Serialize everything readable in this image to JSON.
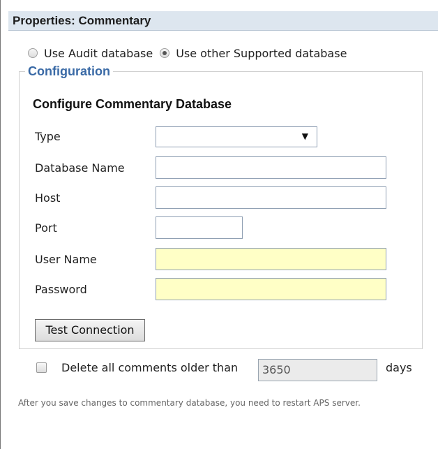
{
  "header": {
    "title": "Properties: Commentary"
  },
  "database_choice": {
    "option_audit": "Use Audit database",
    "option_other": "Use other Supported database",
    "selected": "option_other"
  },
  "configuration": {
    "legend": "Configuration",
    "section_title": "Configure Commentary Database",
    "fields": {
      "type": {
        "label": "Type",
        "value": ""
      },
      "database_name": {
        "label": "Database Name",
        "value": ""
      },
      "host": {
        "label": "Host",
        "value": ""
      },
      "port": {
        "label": "Port",
        "value": ""
      },
      "user_name": {
        "label": "User Name",
        "value": ""
      },
      "password": {
        "label": "Password",
        "value": ""
      }
    },
    "test_button": "Test Connection"
  },
  "retention": {
    "label": "Delete all comments older than",
    "value": "3650",
    "unit": "days",
    "checked": false
  },
  "note": "After you save changes to commentary database, you need to restart APS server.",
  "icons": {
    "dropdown": "triangle-down-icon"
  },
  "colors": {
    "header_bg": "#dde6ef",
    "legend_text": "#3a6aa6",
    "required_field_bg": "#ffffc6",
    "disabled_field_bg": "#ebebeb"
  }
}
